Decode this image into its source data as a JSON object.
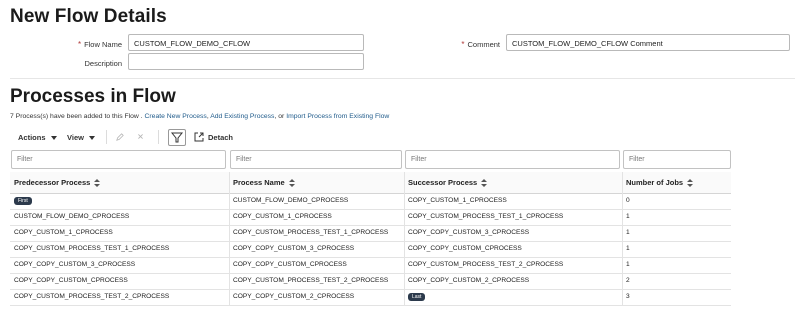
{
  "header": {
    "title": "New Flow Details"
  },
  "form": {
    "flow_name_label": "Flow Name",
    "flow_name_value": "CUSTOM_FLOW_DEMO_CFLOW",
    "description_label": "Description",
    "description_value": "",
    "comment_label": "Comment",
    "comment_value": "CUSTOM_FLOW_DEMO_CFLOW Comment",
    "required_mark": "*"
  },
  "processes": {
    "title": "Processes in Flow",
    "info_prefix": "7 Process(s) have been added to this Flow . ",
    "link_create": "Create New Process",
    "sep1": ", ",
    "link_add": "Add Existing Process",
    "sep2": ", or ",
    "link_import": "Import Process from Existing Flow"
  },
  "toolbar": {
    "actions_label": "Actions",
    "view_label": "View",
    "edit_icon": "pencil-icon",
    "delete_icon": "close-icon",
    "filter_icon": "filter-icon",
    "detach_label": "Detach",
    "detach_icon": "detach-icon"
  },
  "filters": {
    "predecessor_placeholder": "Filter",
    "process_placeholder": "Filter",
    "successor_placeholder": "Filter",
    "jobs_placeholder": "Filter"
  },
  "table": {
    "columns": [
      "Predecessor Process",
      "Process Name",
      "Successor Process",
      "Number of Jobs"
    ],
    "rows": [
      {
        "predecessor": "",
        "predecessor_badge": "First",
        "process": "CUSTOM_FLOW_DEMO_CPROCESS",
        "successor": "COPY_CUSTOM_1_CPROCESS",
        "successor_badge": "",
        "jobs": "0"
      },
      {
        "predecessor": "CUSTOM_FLOW_DEMO_CPROCESS",
        "predecessor_badge": "",
        "process": "COPY_CUSTOM_1_CPROCESS",
        "successor": "COPY_CUSTOM_PROCESS_TEST_1_CPROCESS",
        "successor_badge": "",
        "jobs": "1"
      },
      {
        "predecessor": "COPY_CUSTOM_1_CPROCESS",
        "predecessor_badge": "",
        "process": "COPY_CUSTOM_PROCESS_TEST_1_CPROCESS",
        "successor": "COPY_COPY_CUSTOM_3_CPROCESS",
        "successor_badge": "",
        "jobs": "1"
      },
      {
        "predecessor": "COPY_CUSTOM_PROCESS_TEST_1_CPROCESS",
        "predecessor_badge": "",
        "process": "COPY_COPY_CUSTOM_3_CPROCESS",
        "successor": "COPY_COPY_CUSTOM_CPROCESS",
        "successor_badge": "",
        "jobs": "1"
      },
      {
        "predecessor": "COPY_COPY_CUSTOM_3_CPROCESS",
        "predecessor_badge": "",
        "process": "COPY_COPY_CUSTOM_CPROCESS",
        "successor": "COPY_CUSTOM_PROCESS_TEST_2_CPROCESS",
        "successor_badge": "",
        "jobs": "1"
      },
      {
        "predecessor": "COPY_COPY_CUSTOM_CPROCESS",
        "predecessor_badge": "",
        "process": "COPY_CUSTOM_PROCESS_TEST_2_CPROCESS",
        "successor": "COPY_COPY_CUSTOM_2_CPROCESS",
        "successor_badge": "",
        "jobs": "2"
      },
      {
        "predecessor": "COPY_CUSTOM_PROCESS_TEST_2_CPROCESS",
        "predecessor_badge": "",
        "process": "COPY_COPY_CUSTOM_2_CPROCESS",
        "successor": "",
        "successor_badge": "Last",
        "jobs": "3"
      }
    ]
  },
  "colors": {
    "link": "#1e5a8a",
    "badge_bg": "#2c3a4c",
    "required": "#b13a3a"
  }
}
